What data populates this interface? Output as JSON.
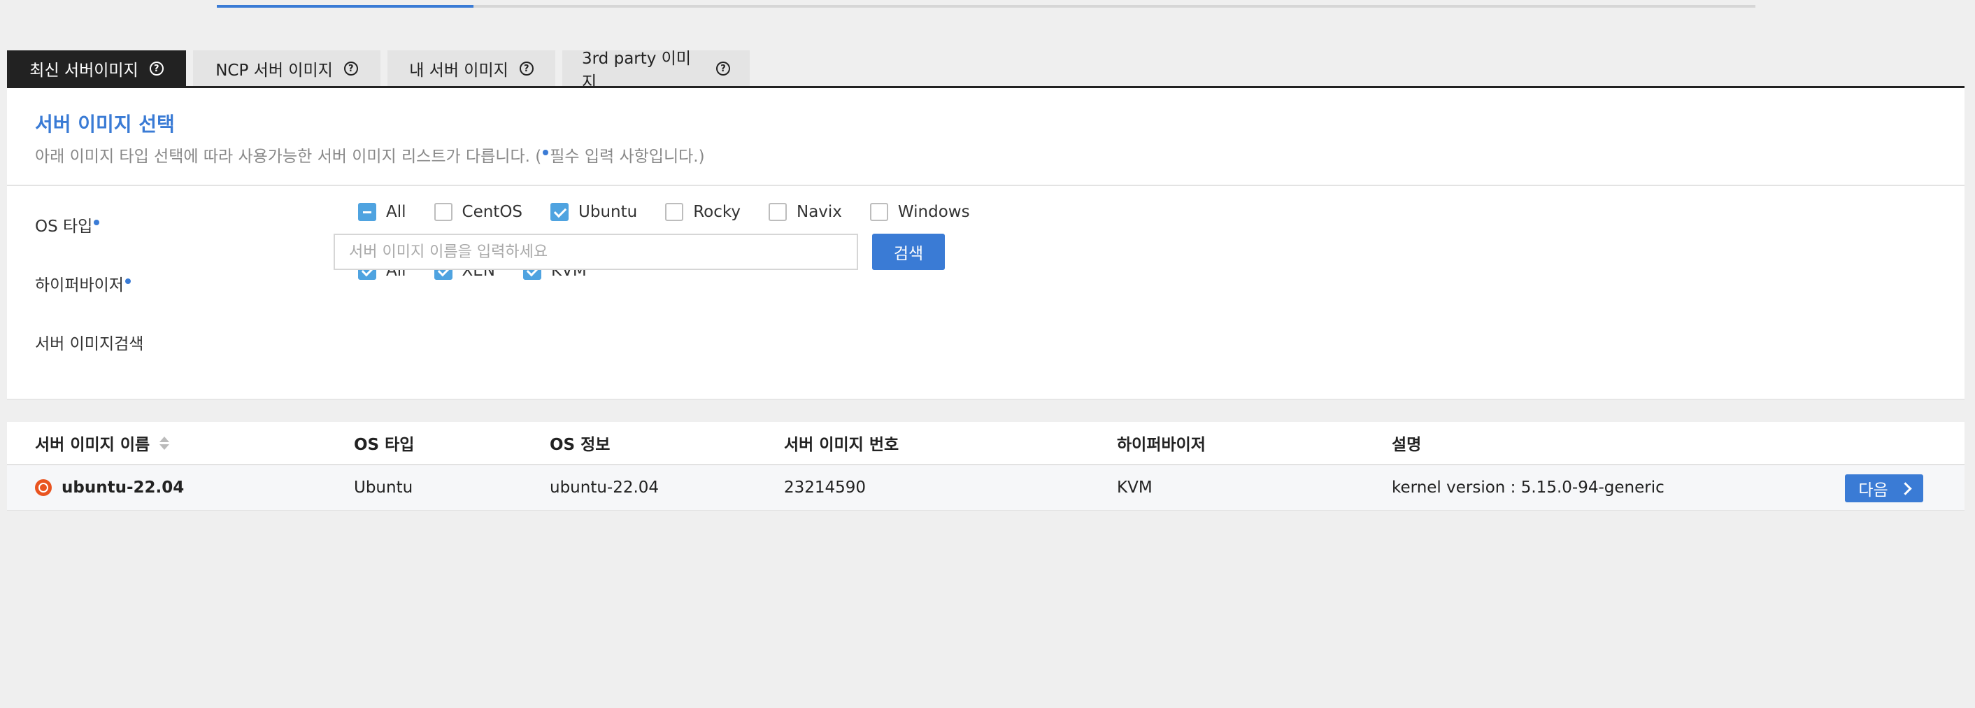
{
  "progress": {
    "fraction": 0.167
  },
  "tabs": [
    {
      "label": "최신 서버이미지",
      "active": true
    },
    {
      "label": "NCP 서버 이미지",
      "active": false
    },
    {
      "label": "내 서버 이미지",
      "active": false
    },
    {
      "label": "3rd party 이미지",
      "active": false
    }
  ],
  "panel": {
    "title": "서버 이미지 선택",
    "desc_prefix": "아래 이미지 타입 선택에 따라 사용가능한 서버 이미지 리스트가 다릅니다. (",
    "desc_suffix": "필수 입력 사항입니다.)"
  },
  "os_filter": {
    "label": "OS 타입",
    "options": [
      {
        "label": "All",
        "state": "partial"
      },
      {
        "label": "CentOS",
        "state": "unchecked"
      },
      {
        "label": "Ubuntu",
        "state": "checked"
      },
      {
        "label": "Rocky",
        "state": "unchecked"
      },
      {
        "label": "Navix",
        "state": "unchecked"
      },
      {
        "label": "Windows",
        "state": "unchecked"
      }
    ]
  },
  "hypervisor_filter": {
    "label": "하이퍼바이저",
    "options": [
      {
        "label": "All",
        "state": "checked"
      },
      {
        "label": "XEN",
        "state": "checked"
      },
      {
        "label": "KVM",
        "state": "checked"
      }
    ]
  },
  "search": {
    "label": "서버 이미지검색",
    "placeholder": "서버 이미지 이름을 입력하세요",
    "value": "",
    "button_label": "검색"
  },
  "table": {
    "columns": [
      "서버 이미지 이름",
      "OS 타입",
      "OS 정보",
      "서버 이미지 번호",
      "하이퍼바이저",
      "설명"
    ],
    "rows": [
      {
        "name": "ubuntu-22.04",
        "os_type": "Ubuntu",
        "os_info": "ubuntu-22.04",
        "image_no": "23214590",
        "hypervisor": "KVM",
        "description": "kernel version : 5.15.0-94-generic",
        "icon": "ubuntu-icon",
        "action_label": "다음"
      }
    ]
  },
  "colors": {
    "accent": "#3a7bd5",
    "checkbox": "#4fa3e0",
    "active_tab": "#222222",
    "ubuntu": "#e95420"
  }
}
